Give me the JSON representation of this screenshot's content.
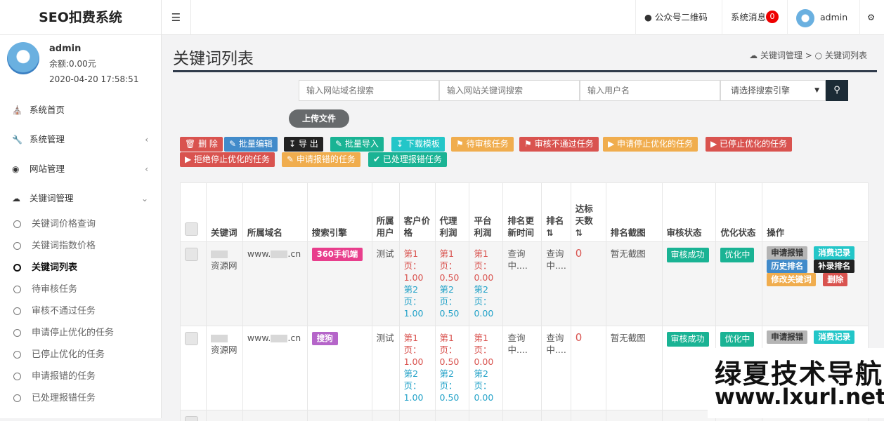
{
  "app_title": "SEO扣费系统",
  "profile": {
    "name": "admin",
    "balance": "余额:0.00元",
    "datetime": "2020-04-20 17:58:51"
  },
  "nav": [
    {
      "label": "系统首页",
      "icon": "home-icon"
    },
    {
      "label": "系统管理",
      "icon": "wrench-icon"
    },
    {
      "label": "网站管理",
      "icon": "circle-icon"
    },
    {
      "label": "关键词管理",
      "icon": "cloud-icon"
    }
  ],
  "subnav": [
    "关键词价格查询",
    "关键词指数价格",
    "关键词列表",
    "待审核任务",
    "审核不通过任务",
    "申请停止优化的任务",
    "已停止优化的任务",
    "申请报错的任务",
    "已处理报错任务"
  ],
  "topbar": {
    "qrcode": "公众号二维码",
    "messages": "系统消息",
    "message_count": "0",
    "user": "admin"
  },
  "page_title": "关键词列表",
  "breadcrumb": {
    "parent": "关键词管理",
    "sep": ">",
    "current": "关键词列表"
  },
  "search": {
    "domain_placeholder": "输入网站域名搜索",
    "keyword_placeholder": "输入网站关键词搜索",
    "user_placeholder": "输入用户名",
    "engine_selected": "请选择搜索引擎"
  },
  "upload_label": "上传文件",
  "actions": [
    "删 除",
    "批量编辑",
    "导 出",
    "批量导入",
    "下载模板",
    "待审核任务",
    "审核不通过任务",
    "申请停止优化的任务",
    "已停止优化的任务",
    "拒绝停止优化的任务",
    "申请报错的任务",
    "已处理报错任务"
  ],
  "table": {
    "headers": [
      "关键词",
      "所属域名",
      "搜索引擎",
      "所属用户",
      "客户价格",
      "代理利润",
      "平台利润",
      "排名更新时间",
      "排名",
      "达标天数",
      "排名截图",
      "审核状态",
      "优化状态",
      "操作"
    ],
    "rows": [
      {
        "keyword": "资源网",
        "domain_prefix": "www.",
        "domain_suffix": ".cn",
        "engine": "360手机端",
        "user": "测试",
        "price_p1": "第1页：1.00",
        "price_p2": "第2页：1.00",
        "agent_p1": "第1页：0.50",
        "agent_p2": "第2页：0.50",
        "plat_p1": "第1页：0.00",
        "plat_p2": "第2页：0.00",
        "update_time": "查询中....",
        "rank": "查询中....",
        "days": "0",
        "screenshot": "暂无截图",
        "audit": "审核成功",
        "optimize": "优化中"
      },
      {
        "keyword": "资源网",
        "domain_prefix": "www.",
        "domain_suffix": ".cn",
        "engine": "搜狗",
        "user": "测试",
        "price_p1": "第1页：1.00",
        "price_p2": "第2页：1.00",
        "agent_p1": "第1页：0.50",
        "agent_p2": "第2页：0.50",
        "plat_p1": "第1页：0.00",
        "plat_p2": "第2页：0.00",
        "update_time": "查询中....",
        "rank": "查询中....",
        "days": "0",
        "screenshot": "暂无截图",
        "audit": "审核成功",
        "optimize": "优化中"
      }
    ],
    "row_ops": [
      "申请报错",
      "消费记录",
      "历史排名",
      "补录排名",
      "修改关键词",
      "删除"
    ]
  },
  "watermark": {
    "line1": "绿夏技术导航",
    "line2": "www.lxurl.net"
  },
  "colors": {
    "danger": "#d9534f",
    "primary": "#428bca",
    "success": "#1ab394",
    "info": "#23c6c8",
    "warning": "#f0ad4e",
    "dark": "#222222"
  }
}
